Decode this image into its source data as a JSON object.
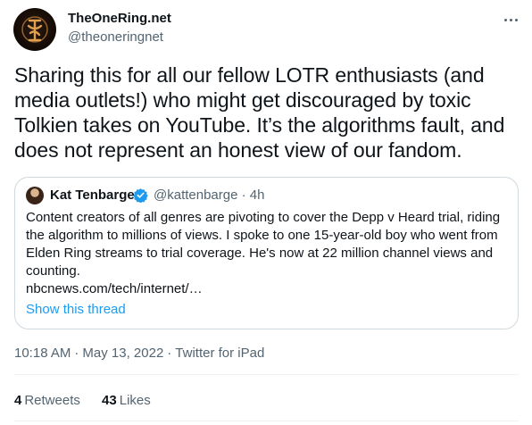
{
  "author": {
    "display_name": "TheOneRing.net",
    "handle": "@theoneringnet"
  },
  "tweet": {
    "text_lines": [
      "Sharing this for all our fellow LOTR enthusiasts (and",
      "media outlets!) who might get discouraged by toxic",
      "Tolkien takes on YouTube. It’s the algorithms fault, and",
      "does not represent an honest view of our fandom."
    ]
  },
  "quoted": {
    "display_name": "Kat Tenbarge",
    "handle": "@kattenbarge",
    "dot": "·",
    "time": "4h",
    "text_lines": [
      "Content creators of all genres are pivoting to cover the Depp v Heard trial, riding",
      "the algorithm to millions of views. I spoke to one 15-year-old boy who went from",
      "Elden Ring streams to trial coverage. He's now at 22 million channel views and",
      "counting.",
      "nbcnews.com/tech/internet/…"
    ],
    "show_thread": "Show this thread"
  },
  "meta": {
    "time": "10:18 AM",
    "sep": "·",
    "date": "May 13, 2022",
    "source": "Twitter for iPad"
  },
  "stats": {
    "retweets_count": "4",
    "retweets_label": "Retweets",
    "likes_count": "43",
    "likes_label": "Likes"
  },
  "colors": {
    "accent": "#1d9bf0",
    "secondary_text": "#536471",
    "border": "#cfd9de"
  },
  "icons": {
    "more": "more-dots-icon",
    "verified": "verified-badge-icon"
  }
}
